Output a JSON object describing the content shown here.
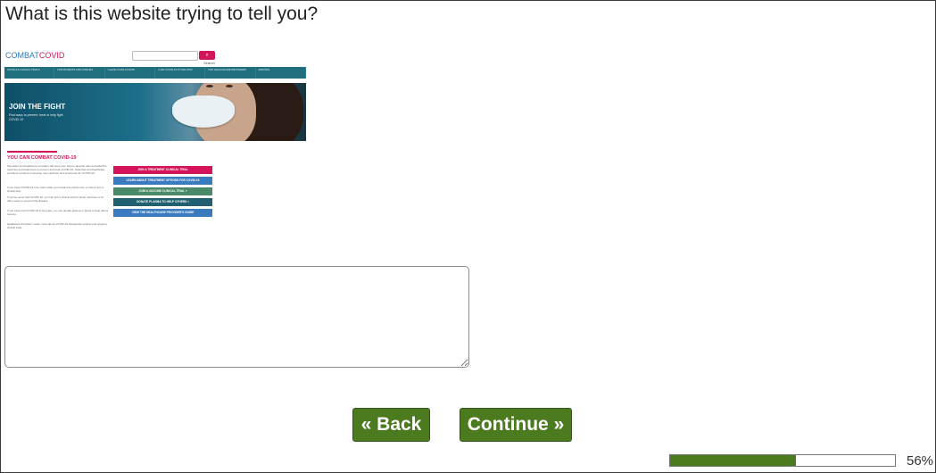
{
  "question": "What is this website trying to tell you?",
  "site": {
    "logo_part1": "COMBAT",
    "logo_part2": "COVID",
    "search_label": "Search",
    "nav": [
      "COVID-19 CLINICAL TRIALS",
      "FOR PATIENTS AND FAMILIES",
      "I HAVE COVID-19 NOW",
      "I HAD COVID-19 IN THE PAST",
      "FOR HEALTHCARE PROVIDERS",
      "ESPAÑOL"
    ],
    "hero_title": "JOIN THE FIGHT",
    "hero_subtitle": "Find ways to prevent, treat or help fight COVID-19",
    "section_title": "YOU CAN COMBAT COVID-19",
    "paragraphs": [
      "Scientists and healthcare providers still need your help to develop safe and effective vaccines and treatments to prevent and treat COVID-19. Scientists and healthcare providers continue to develop new vaccines and treatments for COVID-19.",
      "If you have COVID-19 now, learn what your treatment options are or how to join a clinical trial.",
      "If you've never had COVID-19, you can join a clinical trial for these vaccines or for other ways to prevent this disease.",
      "If you have had COVID-19 in the past, you can donate plasma or blood to help others recover.",
      "Healthcare Providers: Learn more about COVID-19 therapeutic options and ongoing clinical trials."
    ],
    "ctas": [
      {
        "label": "JOIN A TREATMENT CLINICAL TRIAL",
        "color": "#d4145a"
      },
      {
        "label": "LEARN ABOUT TREATMENT OPTIONS FOR COVID-19",
        "color": "#3a7bbf"
      },
      {
        "label": "JOIN A VACCINE CLINICAL TRIAL »",
        "color": "#4a8a68"
      },
      {
        "label": "DONATE PLASMA TO HELP OTHERS »",
        "color": "#1f5f6f"
      },
      {
        "label": "VIEW THE HEALTHCARE PROVIDER'S GUIDE",
        "color": "#3a7bbf"
      }
    ]
  },
  "answer": {
    "value": "",
    "placeholder": ""
  },
  "buttons": {
    "back": "« Back",
    "continue": "Continue »"
  },
  "progress": {
    "percent": 56,
    "label": "56%"
  },
  "colors": {
    "button_green": "#4c7a1f",
    "brand_pink": "#d4145a",
    "brand_blue": "#2b7bb9"
  }
}
